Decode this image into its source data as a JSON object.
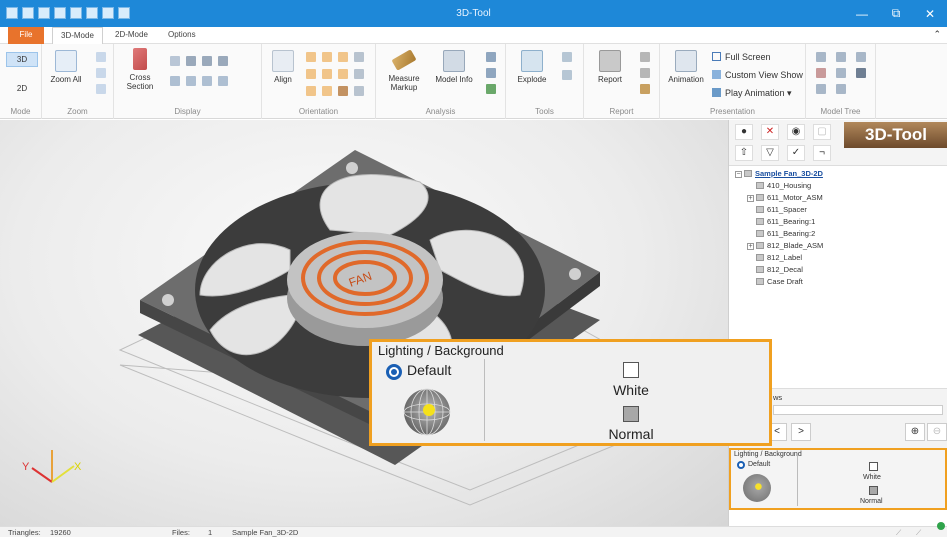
{
  "window": {
    "title": "3D-Tool"
  },
  "tabs": [
    {
      "label": "File"
    },
    {
      "label": "3D-Mode"
    },
    {
      "label": "2D-Mode"
    },
    {
      "label": "Options"
    }
  ],
  "ribbon": {
    "mode": {
      "btn3d": "3D",
      "btn2d": "2D",
      "group": "Mode"
    },
    "zoom": {
      "zoom_all": "Zoom All",
      "group": "Zoom"
    },
    "display": {
      "cross_section_1": "Cross",
      "cross_section_2": "Section",
      "group": "Display"
    },
    "orientation": {
      "align": "Align",
      "group": "Orientation"
    },
    "analysis": {
      "measure_1": "Measure",
      "measure_2": "Markup",
      "model_info": "Model Info",
      "group": "Analysis"
    },
    "tools": {
      "explode": "Explode",
      "group": "Tools"
    },
    "report": {
      "report": "Report",
      "group": "Report"
    },
    "presentation": {
      "animation": "Animation",
      "full_screen": "Full Screen",
      "custom_view": "Custom View Show",
      "play_animation": "Play Animation",
      "group": "Presentation"
    },
    "model_tree": {
      "group": "Model Tree"
    }
  },
  "viewport": {
    "fan_label": "FAN",
    "axis_x": "X",
    "axis_y": "Y"
  },
  "side": {
    "logo": "3D-Tool",
    "tree": [
      {
        "label": "Sample Fan_3D-2D",
        "level": 0,
        "expand": "−",
        "root": true
      },
      {
        "label": "410_Housing",
        "level": 1,
        "expand": ""
      },
      {
        "label": "611_Motor_ASM",
        "level": 1,
        "expand": "+"
      },
      {
        "label": "611_Spacer",
        "level": 1,
        "expand": ""
      },
      {
        "label": "611_Bearing:1",
        "level": 1,
        "expand": ""
      },
      {
        "label": "611_Bearing:2",
        "level": 1,
        "expand": ""
      },
      {
        "label": "812_Blade_ASM",
        "level": 1,
        "expand": "+"
      },
      {
        "label": "812_Label",
        "level": 1,
        "expand": ""
      },
      {
        "label": "812_Decal",
        "level": 1,
        "expand": ""
      },
      {
        "label": "Case Draft",
        "level": 1,
        "expand": ""
      }
    ],
    "views_label": "ws",
    "nav_prev": "<",
    "nav_next": ">"
  },
  "lighting": {
    "title": "Lighting / Background",
    "default": "Default",
    "white": "White",
    "normal": "Normal"
  },
  "status": {
    "triangles_label": "Triangles:",
    "triangles_value": "19260",
    "files_label": "Files:",
    "files_value": "1",
    "file_name": "Sample Fan_3D-2D"
  }
}
